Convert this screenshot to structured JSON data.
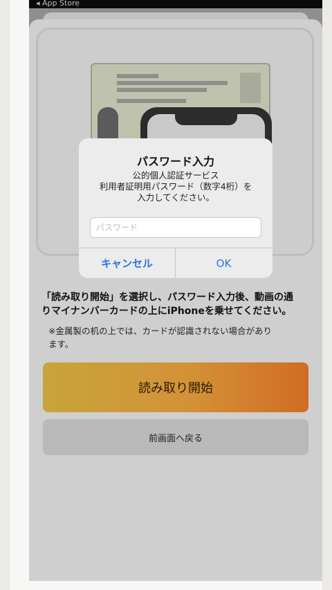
{
  "statusbar": {
    "back_text": "◂ App Store"
  },
  "dialog": {
    "title": "パスワード入力",
    "message_line1": "公的個人認証サービス",
    "message_line2": "利用者証明用パスワード（数字4桁）を",
    "message_line3": "入力してください。",
    "password_placeholder": "パスワード",
    "cancel_label": "キャンセル",
    "ok_label": "OK",
    "accent_color": "#2a74e0"
  },
  "instruction": {
    "line1": "「読み取り開始」を選択し、パスワード入力後、動画の通",
    "line2": "りマイナンバーカードの上にiPhoneを乗せてください。"
  },
  "note": {
    "line1": "※金属製の机の上では、カードが認識されない場合があり",
    "line2": "ます。"
  },
  "buttons": {
    "start_label": "読み取り開始",
    "back_label": "前画面へ戻る"
  },
  "icons": {
    "card_illustration": "my-number-card-illustration",
    "phone_illustration": "iphone-illustration"
  }
}
